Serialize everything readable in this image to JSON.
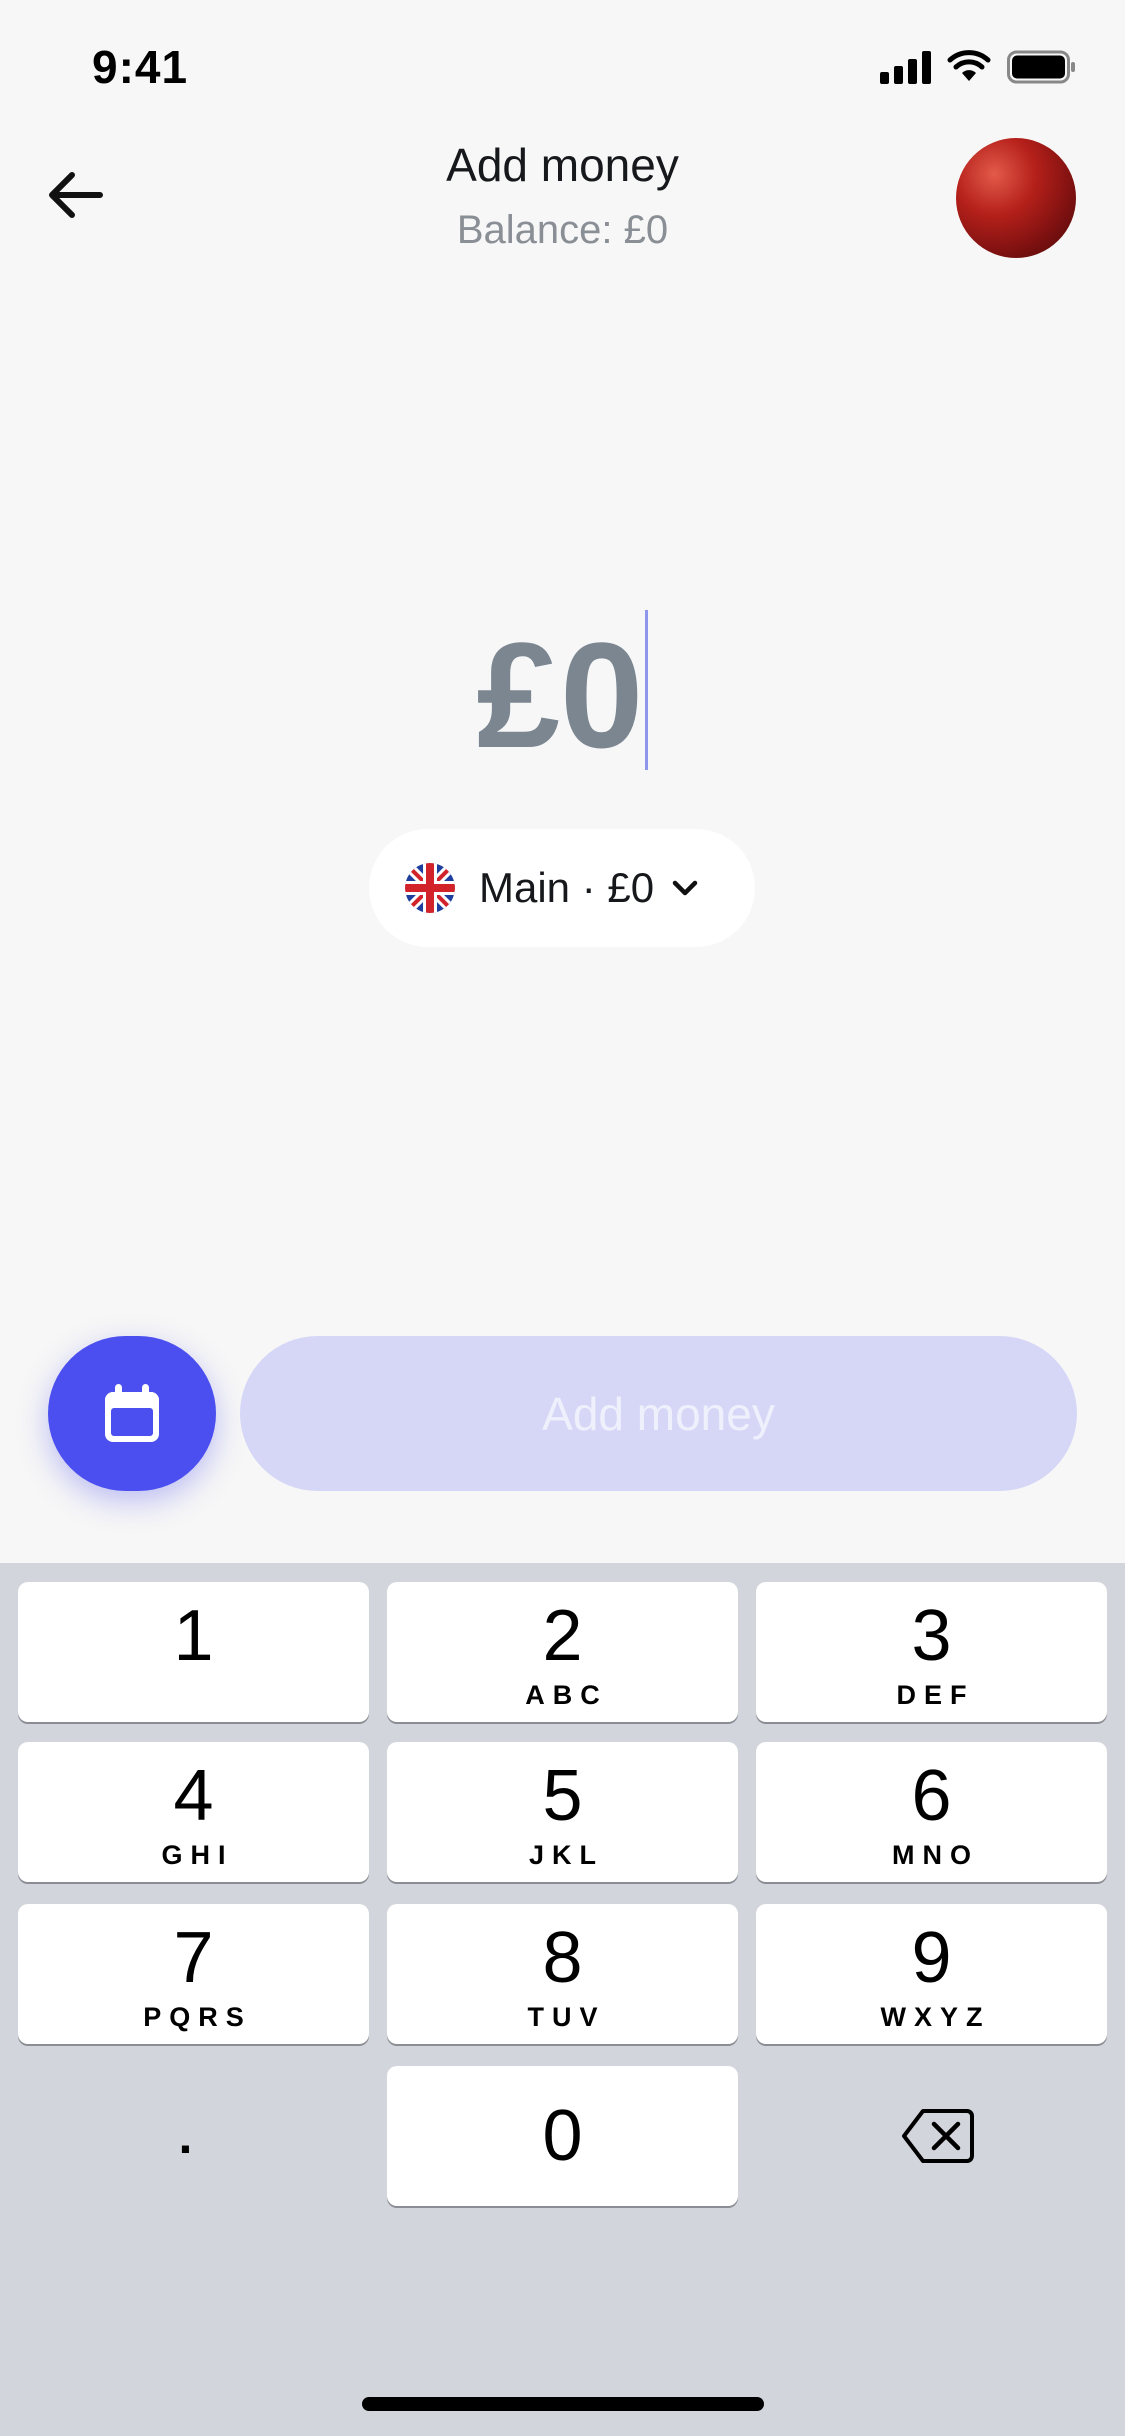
{
  "status_bar": {
    "time": "9:41",
    "icons": [
      "signal-icon",
      "wifi-icon",
      "battery-icon"
    ]
  },
  "header": {
    "back_icon": "arrow-left-icon",
    "title": "Add money",
    "subtitle": "Balance: £0",
    "avatar": "avatar"
  },
  "amount": {
    "value": "£0"
  },
  "account_selector": {
    "flag_icon": "uk-flag-icon",
    "label": "Main · £0",
    "chevron_icon": "chevron-down-icon"
  },
  "actions": {
    "schedule_icon": "calendar-icon",
    "primary_label": "Add money",
    "primary_enabled": false
  },
  "keypad": {
    "keys": [
      {
        "digit": "1",
        "letters": ""
      },
      {
        "digit": "2",
        "letters": "ABC"
      },
      {
        "digit": "3",
        "letters": "DEF"
      },
      {
        "digit": "4",
        "letters": "GHI"
      },
      {
        "digit": "5",
        "letters": "JKL"
      },
      {
        "digit": "6",
        "letters": "MNO"
      },
      {
        "digit": "7",
        "letters": "PQRS"
      },
      {
        "digit": "8",
        "letters": "TUV"
      },
      {
        "digit": "9",
        "letters": "WXYZ"
      }
    ],
    "decimal": ".",
    "zero": "0",
    "delete_icon": "backspace-icon"
  },
  "colors": {
    "accent": "#4c4fef",
    "accent_disabled": "#d6d7f7",
    "amount_text": "#7b8691",
    "keyboard_bg": "#d2d5db"
  }
}
